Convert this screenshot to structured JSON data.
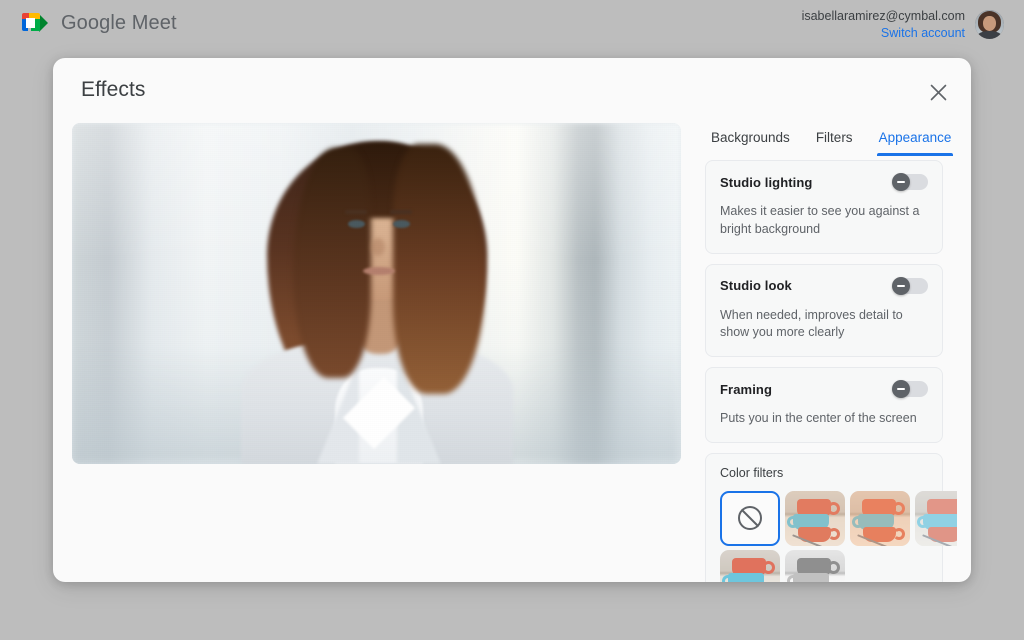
{
  "app": {
    "brand_name": "Google Meet",
    "logo_icon": "google-meet-logo"
  },
  "account": {
    "email": "isabellaramirez@cymbal.com",
    "switch_label": "Switch account",
    "avatar_icon": "user-avatar"
  },
  "dialog": {
    "title": "Effects",
    "close_icon": "close-icon"
  },
  "video_preview": {
    "label": "self-view-video-preview"
  },
  "tabs": [
    {
      "label": "Backgrounds",
      "active": false
    },
    {
      "label": "Filters",
      "active": false
    },
    {
      "label": "Appearance",
      "active": true
    }
  ],
  "settings": [
    {
      "title": "Studio lighting",
      "description": "Makes it easier to see you against a bright background",
      "toggle_state": "off"
    },
    {
      "title": "Studio look",
      "description": "When needed, improves detail to show you more clearly",
      "toggle_state": "off"
    },
    {
      "title": "Framing",
      "description": "Puts you in the center of the screen",
      "toggle_state": "off"
    }
  ],
  "color_filters": {
    "title": "Color filters",
    "items": [
      {
        "name": "No filter",
        "style": "none",
        "selected": true
      },
      {
        "name": "Filter 1",
        "style": "warm1",
        "selected": false
      },
      {
        "name": "Filter 2",
        "style": "warm2",
        "selected": false
      },
      {
        "name": "Filter 3",
        "style": "cool",
        "selected": false
      },
      {
        "name": "Filter 4",
        "style": "plain",
        "selected": false
      },
      {
        "name": "Filter 5",
        "style": "bw",
        "selected": false
      }
    ]
  },
  "colors": {
    "accent": "#1a73e8",
    "page_background": "#bdbdbd",
    "dialog_background": "#fafafa",
    "text_primary": "#202124",
    "text_secondary": "#5f6368"
  }
}
